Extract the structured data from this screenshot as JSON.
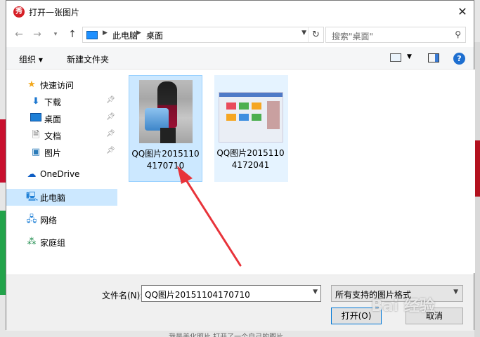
{
  "window": {
    "title": "打开一张图片",
    "app_icon_text": "秀"
  },
  "navigation": {
    "breadcrumb": [
      "此电脑",
      "桌面"
    ],
    "search_placeholder": "搜索\"桌面\""
  },
  "toolbar": {
    "organize_label": "组织",
    "new_folder_label": "新建文件夹",
    "help_label": "?"
  },
  "sidebar": {
    "quick_access": "快速访问",
    "items": [
      {
        "label": "下载",
        "icon": "download-icon",
        "pinned": true
      },
      {
        "label": "桌面",
        "icon": "desktop-icon",
        "pinned": true
      },
      {
        "label": "文档",
        "icon": "document-icon",
        "pinned": true
      },
      {
        "label": "图片",
        "icon": "pictures-icon",
        "pinned": true
      }
    ],
    "onedrive": "OneDrive",
    "this_pc": "此电脑",
    "network": "网络",
    "homegroup": "家庭组"
  },
  "files": [
    {
      "name": "QQ图片20151104170710",
      "selected": true
    },
    {
      "name": "QQ图片20151104172041",
      "selected": false
    }
  ],
  "footer": {
    "filename_label": "文件名(N):",
    "filename_value": "QQ图片20151104170710",
    "filetype_value": "所有支持的图片格式",
    "open_label": "打开(O)",
    "cancel_label": "取消"
  },
  "overlay": {
    "watermark": "Bai 经验",
    "caption": "我是美化照片  打开了一个自己的图片"
  },
  "colors": {
    "accent": "#0078d7",
    "selection": "#cce8ff",
    "arrow": "#e8333a"
  }
}
